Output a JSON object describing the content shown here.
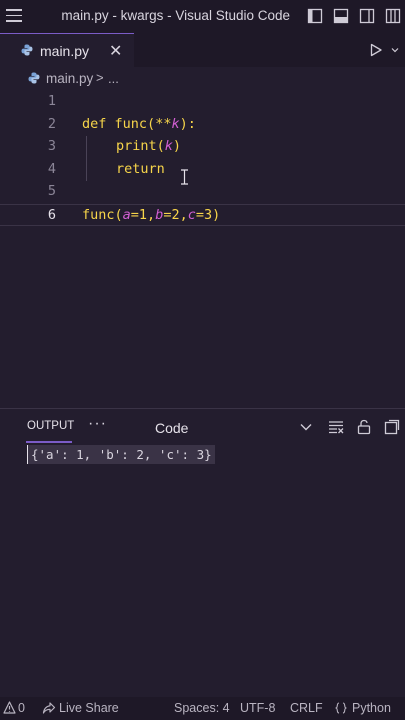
{
  "window": {
    "title": "main.py - kwargs - Visual Studio Code"
  },
  "tab": {
    "label": "main.py",
    "close_glyph": "✕"
  },
  "breadcrumb": {
    "file": "main.py",
    "separator": ">",
    "more": "..."
  },
  "editor": {
    "lines": [
      {
        "number": "1"
      },
      {
        "number": "2"
      },
      {
        "number": "3"
      },
      {
        "number": "4"
      },
      {
        "number": "5"
      },
      {
        "number": "6"
      }
    ],
    "code": {
      "l2_def": "def",
      "l2_func": "func",
      "l2_open": "(",
      "l2_stars": "**",
      "l2_k": "k",
      "l2_close": "):",
      "l3_print": "print",
      "l3_open": "(",
      "l3_k": "k",
      "l3_close": ")",
      "l4_return": "return",
      "l6_func": "func",
      "l6_open": "(",
      "l6_a": "a",
      "l6_aeq": "=1,",
      "l6_b": "b",
      "l6_beq": "=2,",
      "l6_c": "c",
      "l6_ceq": "=3)"
    }
  },
  "panel": {
    "tab_label": "OUTPUT",
    "more_glyph": "···",
    "channel": "Code",
    "output": "{'a': 1, 'b': 2, 'c': 3}"
  },
  "status": {
    "warnings": "0",
    "live_share": "Live Share",
    "spaces": "Spaces: 4",
    "encoding": "UTF-8",
    "eol": "CRLF",
    "language": "Python"
  },
  "colors": {
    "accent": "#7b5cc7",
    "keyword": "#f7d54a",
    "param": "#d15fd2",
    "background": "#231d2e"
  }
}
